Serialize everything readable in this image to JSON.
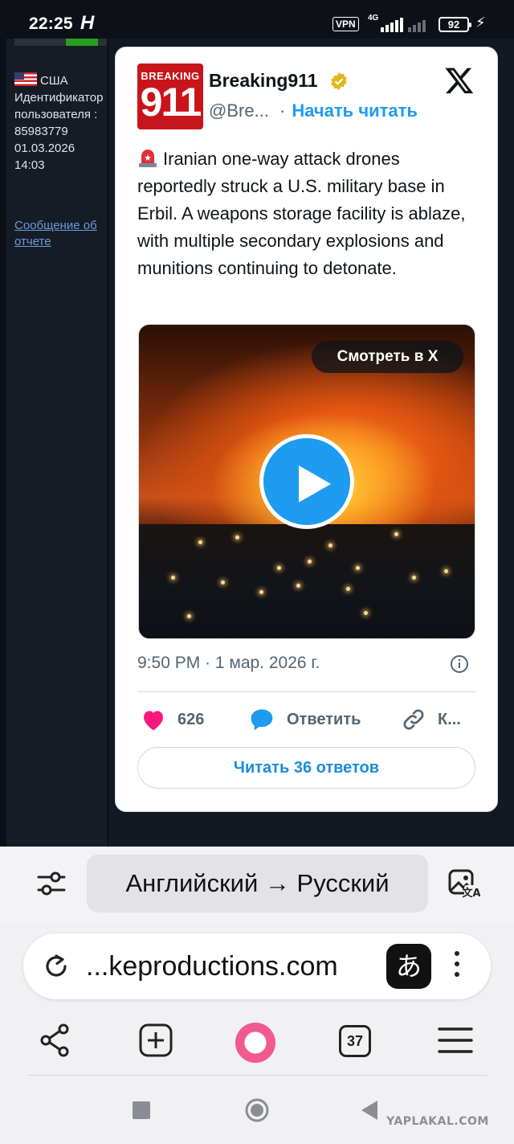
{
  "status_bar": {
    "time": "22:25",
    "notification_glyph": "H",
    "vpn_label": "VPN",
    "network_label": "4G",
    "battery": "92"
  },
  "forum": {
    "country": "США",
    "user_id": "Идентификатор пользователя : 85983779",
    "date": "01.03.2026",
    "time": "14:03",
    "report_link": "Сообщение об отчете"
  },
  "tweet": {
    "logo_top": "BREAKING",
    "logo_number": "911",
    "display_name": "Breaking911",
    "handle": "@Bre...",
    "separator": "·",
    "follow_label": "Начать читать",
    "text": "Iranian one-way attack drones reportedly struck a U.S. military base in Erbil. A weapons storage facility is ablaze, with multiple secondary explosions and munitions continuing to detonate.",
    "watch_label": "Смотреть в X",
    "timestamp": "9:50 PM · 1 мар. 2026 г.",
    "likes": "626",
    "reply_label": "Ответить",
    "copy_label": "К...",
    "read_replies_label": "Читать 36 ответов",
    "colors": {
      "accent": "#1d9bf0",
      "like": "#f91880",
      "text": "#0f1419",
      "muted": "#536471"
    }
  },
  "browser": {
    "translation": "Английский → Русский",
    "url": "...keproductions.com",
    "translate_glyph": "あ",
    "tab_count": "37"
  },
  "watermark": "YAPLAKAL.COM",
  "icons": [
    "x-logo-icon",
    "verified-badge-icon",
    "siren-icon",
    "play-icon",
    "info-icon",
    "heart-icon",
    "reply-bubble-icon",
    "link-icon",
    "filter-sliders-icon",
    "image-translate-icon",
    "reload-icon",
    "kebab-menu-icon",
    "share-icon",
    "new-tab-icon",
    "alice-assistant-icon",
    "menu-icon",
    "square-icon",
    "circle-icon",
    "back-triangle-icon"
  ]
}
